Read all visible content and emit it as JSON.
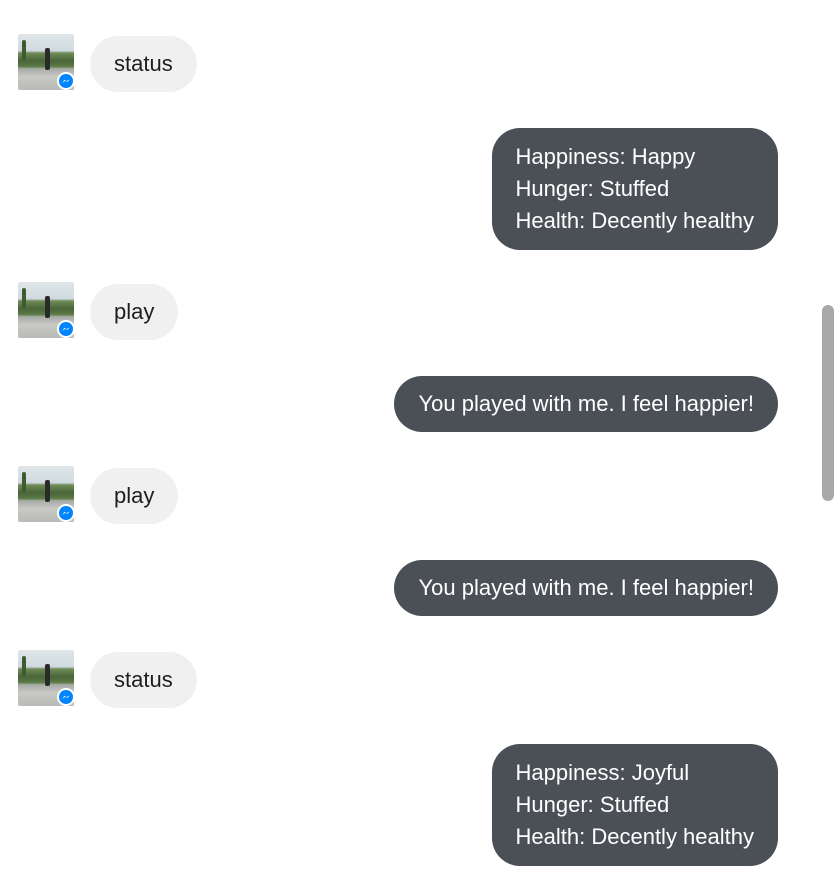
{
  "conversation": {
    "messages": [
      {
        "from": "user",
        "text": "status"
      },
      {
        "from": "bot",
        "lines": [
          "Happiness: Happy",
          "Hunger: Stuffed",
          "Health: Decently healthy"
        ]
      },
      {
        "from": "user",
        "text": "play"
      },
      {
        "from": "bot",
        "lines": [
          "You played with me. I feel happier!"
        ]
      },
      {
        "from": "user",
        "text": "play"
      },
      {
        "from": "bot",
        "lines": [
          "You played with me. I feel happier!"
        ]
      },
      {
        "from": "user",
        "text": "status"
      },
      {
        "from": "bot",
        "lines": [
          "Happiness: Joyful",
          "Hunger: Stuffed",
          "Health: Decently healthy"
        ]
      }
    ]
  },
  "icons": {
    "avatar": "user-avatar-photo",
    "badge": "messenger-badge-icon"
  },
  "colors": {
    "incoming_bubble": "#f0f0f0",
    "outgoing_bubble": "#4b4f56",
    "messenger_blue": "#0084ff",
    "scrollbar_thumb": "#a9a9a9"
  }
}
